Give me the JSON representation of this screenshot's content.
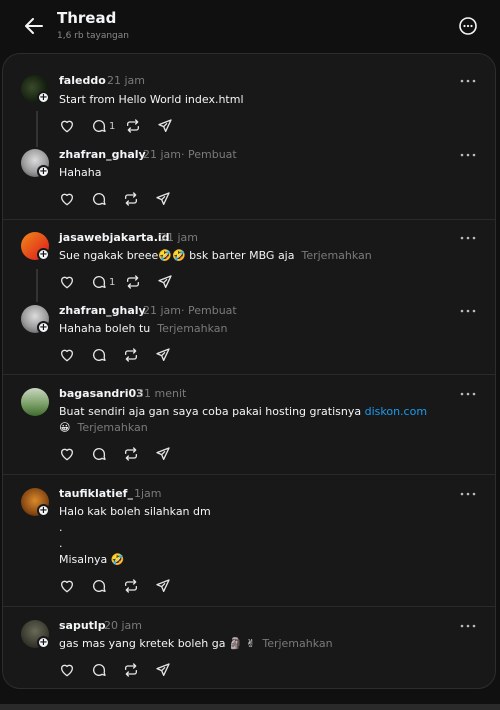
{
  "header": {
    "title": "Thread",
    "subtitle": "1,6 rb tayangan"
  },
  "posts": [
    {
      "username": "faleddo",
      "time": "21 jam",
      "text": "Start from Hello World index.html",
      "reply_count": "1"
    },
    {
      "username": "zhafran_ghaly",
      "time": "21 jam",
      "author_tag": "· Pembuat",
      "text": "Hahaha"
    },
    {
      "username": "jasawebjakarta.id",
      "time": "21 jam",
      "text": "Sue ngakak breee🤣🤣 bsk barter MBG aja",
      "translate": "Terjemahkan",
      "reply_count": "1"
    },
    {
      "username": "zhafran_ghaly",
      "time": "21 jam",
      "author_tag": "· Pembuat",
      "text": "Hahaha boleh tu",
      "translate": "Terjemahkan"
    },
    {
      "username": "bagasandri03",
      "time": "31 menit",
      "text": "Buat sendiri aja gan saya coba pakai hosting gratisnya",
      "link": "diskon.com",
      "line2_emoji": "😀",
      "translate": "Terjemahkan"
    },
    {
      "username": "taufiklatief_",
      "time": "1jam",
      "text": "Halo kak boleh silahkan dm",
      "dot1": ".",
      "dot2": ".",
      "text2": "Misalnya 🤣"
    },
    {
      "username": "saputlp",
      "time": "20 jam",
      "text": "gas mas yang kretek boleh ga 🗿 ✌",
      "translate": "Terjemahkan"
    }
  ],
  "icons": {
    "back": "arrow-left-icon",
    "more": "more-circle-icon",
    "like": "heart-icon",
    "reply": "comment-icon",
    "repost": "repost-icon",
    "share": "send-icon"
  },
  "colors": {
    "background": "#101010",
    "panel": "#181818",
    "link": "#1d9bf0",
    "muted": "#7a7a7a"
  }
}
